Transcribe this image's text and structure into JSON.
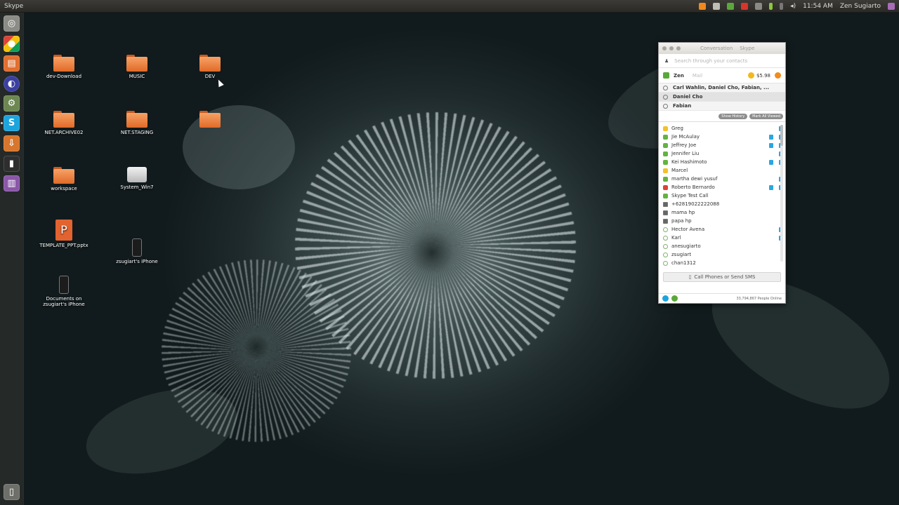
{
  "top_panel": {
    "app_title": "Skype",
    "clock": "11:54 AM",
    "user": "Zen Sugiarto"
  },
  "launcher": {
    "items": [
      {
        "name": "dash",
        "color": "#8c8c86",
        "glyph": "◎"
      },
      {
        "name": "chrome",
        "color": "#3c9a49",
        "glyph": "●"
      },
      {
        "name": "files",
        "color": "#e16f2f",
        "glyph": "▤"
      },
      {
        "name": "eclipse",
        "color": "#3a3fa0",
        "glyph": "◐"
      },
      {
        "name": "settings",
        "color": "#6d8752",
        "glyph": "⚙"
      },
      {
        "name": "skype",
        "color": "#1ea4dd",
        "glyph": "S"
      },
      {
        "name": "download",
        "color": "#d7762c",
        "glyph": "⇩"
      },
      {
        "name": "terminal",
        "color": "#2e2e2e",
        "glyph": "▮"
      },
      {
        "name": "workspaces",
        "color": "#8a57a8",
        "glyph": "▥"
      },
      {
        "name": "trash",
        "color": "#6f6f6a",
        "glyph": "🗑"
      }
    ]
  },
  "desktop": {
    "icons": [
      {
        "label": "dev-Download",
        "type": "folder"
      },
      {
        "label": "MUSIC",
        "type": "folder"
      },
      {
        "label": "DEV",
        "type": "folder"
      },
      {
        "label": "NET.ARCHIVE02",
        "type": "folder"
      },
      {
        "label": "NET.STAGING",
        "type": "folder"
      },
      {
        "label": "",
        "type": "folder"
      },
      {
        "label": "workspace",
        "type": "folder"
      },
      {
        "label": "System_Win7",
        "type": "drive"
      },
      {
        "label": "TEMPLATE_PPT.pptx",
        "type": "pptx"
      },
      {
        "label": "zsugiart's iPhone",
        "type": "phone"
      },
      {
        "label": "Documents on zsugiart's iPhone",
        "type": "phone"
      }
    ]
  },
  "skype": {
    "menus": [
      "Conversation",
      "Skype"
    ],
    "search_placeholder": "Search through your contacts",
    "profile_name": "Zen",
    "profile_tab": "Mail",
    "credit": "$5.98",
    "conversations": [
      {
        "label": "Carl Wahlin, Daniel Cho, Fabian, ...",
        "selected": false
      },
      {
        "label": "Daniel Cho",
        "selected": true
      },
      {
        "label": "Fabian",
        "selected": false
      }
    ],
    "history_buttons": [
      "Show History",
      "Mark All Viewed"
    ],
    "contacts": [
      {
        "name": "Greg",
        "status": "away",
        "badges": 1
      },
      {
        "name": "Jie McAulay",
        "status": "online",
        "badges": 2
      },
      {
        "name": "Jeffrey Joe",
        "status": "online",
        "badges": 2
      },
      {
        "name": "Jennifer Liu",
        "status": "online",
        "badges": 1
      },
      {
        "name": "Kei Hashimoto",
        "status": "online",
        "badges": 2
      },
      {
        "name": "Marcel",
        "status": "away",
        "badges": 0
      },
      {
        "name": "martha dewi yusuf",
        "status": "online",
        "badges": 1
      },
      {
        "name": "Roberto Bernardo",
        "status": "dnd",
        "badges": 2
      },
      {
        "name": "Skype Test Call",
        "status": "online",
        "badges": 0
      },
      {
        "name": "+62819022222088",
        "status": "phone",
        "badges": 0
      },
      {
        "name": "mama hp",
        "status": "phone",
        "badges": 0
      },
      {
        "name": "papa hp",
        "status": "phone",
        "badges": 0
      },
      {
        "name": "Hector Avena",
        "status": "offline",
        "badges": 1
      },
      {
        "name": "Karl",
        "status": "offline",
        "badges": 1
      },
      {
        "name": "anesugiarto",
        "status": "offline",
        "badges": 0
      },
      {
        "name": "zsugiart",
        "status": "offline",
        "badges": 0
      },
      {
        "name": "chan1312",
        "status": "offline",
        "badges": 0
      }
    ],
    "call_button": "Call Phones or Send SMS",
    "people_online": "33,794,867 People Online"
  }
}
